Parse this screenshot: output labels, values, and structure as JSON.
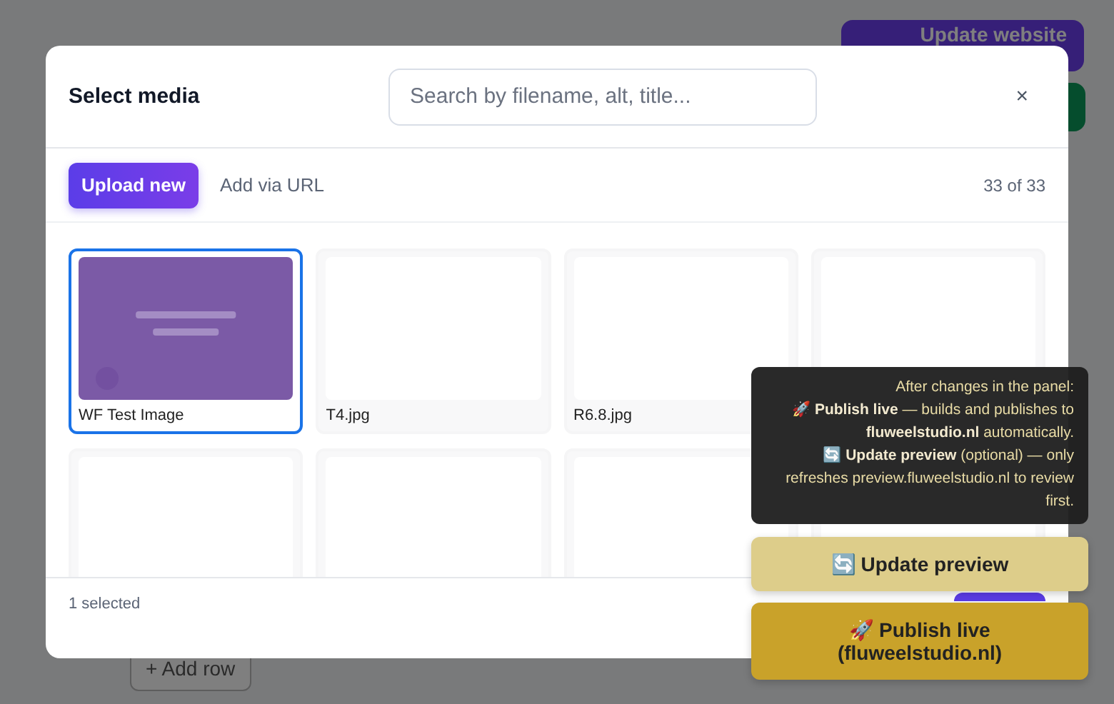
{
  "background": {
    "update_button": "Update website",
    "add_row_button": "+ Add row"
  },
  "modal": {
    "title": "Select media",
    "search": {
      "placeholder": "Search by filename, alt, title..."
    },
    "close": "×",
    "upload_button": "Upload new",
    "url_link": "Add via URL",
    "count": "33 of 33",
    "items": [
      {
        "label": "WF Test Image",
        "kind": "picture",
        "selected": true
      },
      {
        "label": "T4.jpg",
        "kind": "blank",
        "selected": false
      },
      {
        "label": "R6.8.jpg",
        "kind": "blank",
        "selected": false
      },
      {
        "kind": "blank",
        "selected": false
      },
      {
        "kind": "blank",
        "selected": false
      },
      {
        "kind": "blank",
        "selected": false
      },
      {
        "kind": "blank",
        "selected": false
      },
      {
        "kind": "blank",
        "selected": false
      }
    ],
    "footer": {
      "selection": "1 selected"
    }
  },
  "deploy_panel": {
    "tooltip": "After changes in the panel:\n🚀 **Publish live** — builds and publishes to **fluweelstudio.nl** automatically.\n🔄 **Update preview** (optional) — only refreshes preview.fluweelstudio.nl to review first.",
    "update_button": "🔄 Update preview",
    "publish_button": "🚀 Publish live\n(fluweelstudio.nl)"
  }
}
